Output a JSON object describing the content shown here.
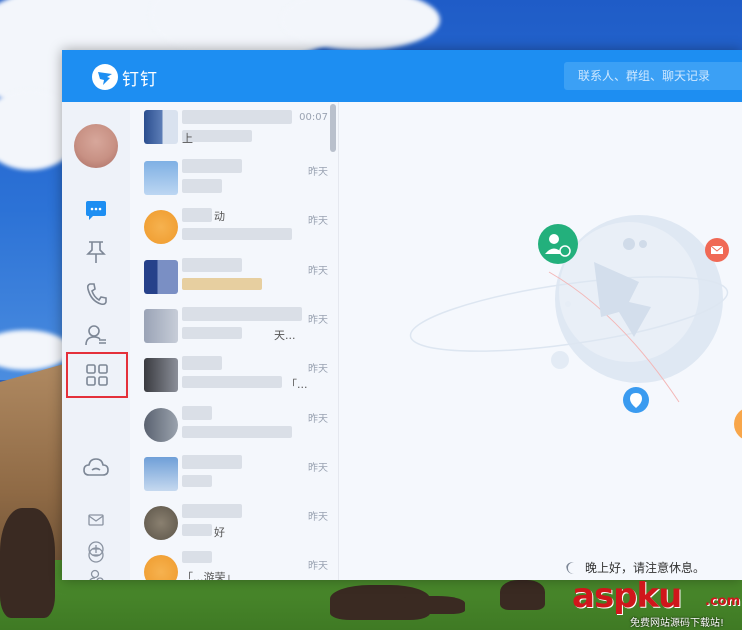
{
  "app": {
    "name": "钉钉",
    "search_placeholder": "联系人、群组、聊天记录"
  },
  "sidebar": {
    "items": [
      {
        "name": "messages",
        "icon": "chat-bubble-icon",
        "active": true
      },
      {
        "name": "ding",
        "icon": "pin-icon"
      },
      {
        "name": "calls",
        "icon": "phone-icon"
      },
      {
        "name": "contacts",
        "icon": "contacts-icon"
      },
      {
        "name": "workbench",
        "icon": "grid-apps-icon",
        "highlighted": true
      },
      {
        "name": "cloud",
        "icon": "cloud-icon"
      }
    ],
    "bottom_items": [
      {
        "name": "mail",
        "icon": "mail-icon"
      },
      {
        "name": "add",
        "icon": "plus-circle-icon"
      },
      {
        "name": "add-friend",
        "icon": "user-add-icon"
      },
      {
        "name": "more",
        "icon": "more-circle-icon"
      }
    ]
  },
  "chat_list": {
    "items": [
      {
        "time": "00:07",
        "snippet": "上"
      },
      {
        "time": "昨天",
        "snippet": ""
      },
      {
        "time": "昨天",
        "snippet": "动"
      },
      {
        "time": "昨天",
        "snippet": ""
      },
      {
        "time": "昨天",
        "snippet": "天..."
      },
      {
        "time": "昨天",
        "snippet": "「..."
      },
      {
        "time": "昨天",
        "snippet": ""
      },
      {
        "time": "昨天",
        "snippet": ""
      },
      {
        "time": "昨天",
        "snippet": "好"
      },
      {
        "time": "昨天",
        "snippet": "「...游荣」"
      }
    ]
  },
  "main": {
    "greeting": "晚上好，请注意休息。"
  },
  "watermark": {
    "brand": "aspku",
    "suffix": ".com",
    "subtitle": "免费网站源码下载站!"
  },
  "colors": {
    "titlebar": "#1d8ef2",
    "accent": "#1d8ef2",
    "highlight_box": "#e4303a"
  }
}
